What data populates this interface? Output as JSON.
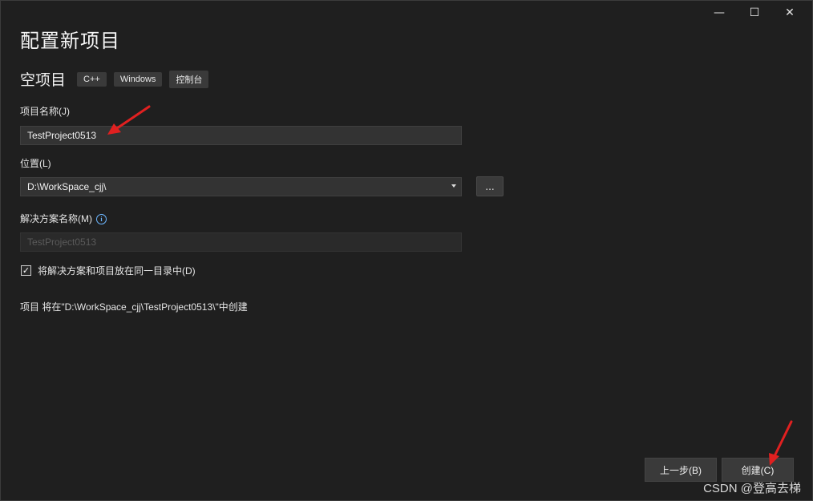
{
  "window": {
    "minimize_glyph": "—",
    "maximize_glyph": "☐",
    "close_glyph": "✕"
  },
  "page": {
    "title": "配置新项目"
  },
  "template": {
    "name": "空项目",
    "tags": [
      "C++",
      "Windows",
      "控制台"
    ]
  },
  "form": {
    "project_name_label": "项目名称(J)",
    "project_name_value": "TestProject0513",
    "location_label": "位置(L)",
    "location_value": "D:\\WorkSpace_cjj\\",
    "browse_label": "...",
    "solution_name_label": "解决方案名称(M)",
    "solution_name_value": "TestProject0513",
    "same_dir_checkbox_label": "将解决方案和项目放在同一目录中(D)",
    "same_dir_checked": true,
    "checkmark_glyph": "✓",
    "info_glyph": "i",
    "path_note": "项目 将在\"D:\\WorkSpace_cjj\\TestProject0513\\\"中创建"
  },
  "buttons": {
    "back_label": "上一步(B)",
    "create_label": "创建(C)"
  },
  "watermark": "CSDN @登高去梯",
  "colors": {
    "background": "#1f1f1f",
    "annotation_arrow": "#e02020",
    "info_accent": "#6cb6ff"
  }
}
